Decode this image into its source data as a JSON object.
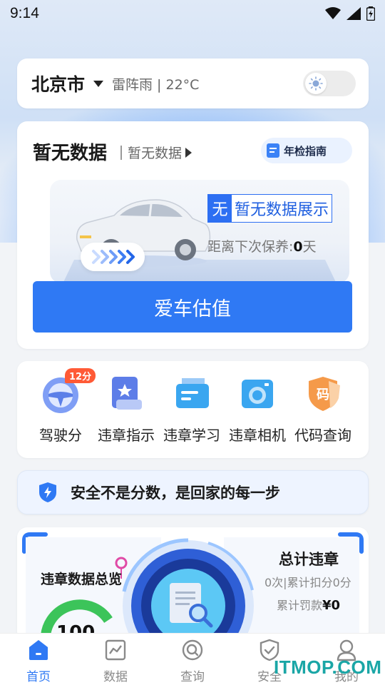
{
  "status_bar": {
    "time": "9:14"
  },
  "location": {
    "city": "北京市",
    "weather": "雷阵雨 | 22°C"
  },
  "vehicle": {
    "title": "暂无数据",
    "subtitle": "暂无数据",
    "guide_label": "年检指南",
    "badge_mark": "无",
    "badge_text": "暂无数据展示",
    "maintenance_prefix": "距离下次保养:",
    "maintenance_days": "0",
    "maintenance_unit": "天",
    "valuation_label": "爱车估值"
  },
  "shortcuts": [
    {
      "label": "驾驶分",
      "badge": "12分",
      "icon": "steering-wheel-icon"
    },
    {
      "label": "违章指示",
      "icon": "star-book-icon"
    },
    {
      "label": "违章学习",
      "icon": "study-card-icon"
    },
    {
      "label": "违章相机",
      "icon": "camera-icon"
    },
    {
      "label": "代码查询",
      "icon": "code-shield-icon"
    }
  ],
  "slogan": "安全不是分数，是回家的每一步",
  "stats": {
    "overview_title": "违章数据总览",
    "total_title": "总计违章",
    "total_line": "0次|累计扣分0分",
    "fine_prefix": "累计罚款",
    "fine_value": "¥0",
    "score": "100"
  },
  "tabs": [
    {
      "label": "首页",
      "icon": "home-icon",
      "active": true
    },
    {
      "label": "数据",
      "icon": "chart-icon",
      "active": false
    },
    {
      "label": "查询",
      "icon": "search-icon",
      "active": false
    },
    {
      "label": "安全",
      "icon": "shield-icon",
      "active": false
    },
    {
      "label": "我的",
      "icon": "user-icon",
      "active": false
    }
  ],
  "watermark": "ITMOP.COM",
  "colors": {
    "accent": "#2f79f4",
    "badge_red": "#ff5a36",
    "green": "#3cc45a"
  }
}
